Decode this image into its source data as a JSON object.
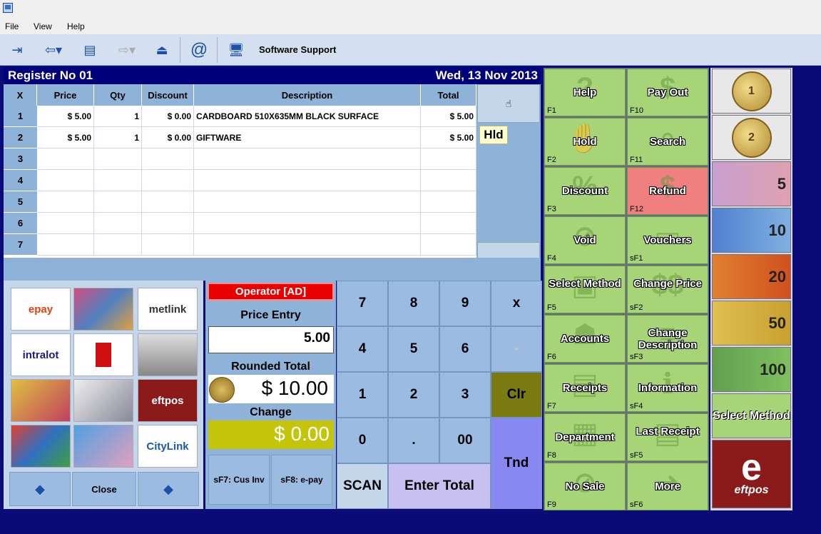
{
  "menu": [
    "File",
    "View",
    "Help"
  ],
  "toolbar": {
    "support_label": "Software Support"
  },
  "header": {
    "register": "Register No 01",
    "date": "Wed, 13 Nov 2013"
  },
  "grid": {
    "columns": [
      "X",
      "Price",
      "Qty",
      "Discount",
      "Description",
      "Total"
    ],
    "rows": [
      {
        "n": "1",
        "price": "$ 5.00",
        "qty": "1",
        "discount": "$ 0.00",
        "desc": "CARDBOARD 510X635MM BLACK SURFACE",
        "total": "$ 5.00"
      },
      {
        "n": "2",
        "price": "$ 5.00",
        "qty": "1",
        "discount": "$ 0.00",
        "desc": "GIFTWARE",
        "total": "$ 5.00"
      },
      {
        "n": "3",
        "price": "",
        "qty": "",
        "discount": "",
        "desc": "",
        "total": ""
      },
      {
        "n": "4",
        "price": "",
        "qty": "",
        "discount": "",
        "desc": "",
        "total": ""
      },
      {
        "n": "5",
        "price": "",
        "qty": "",
        "discount": "",
        "desc": "",
        "total": ""
      },
      {
        "n": "6",
        "price": "",
        "qty": "",
        "discount": "",
        "desc": "",
        "total": ""
      },
      {
        "n": "7",
        "price": "",
        "qty": "",
        "discount": "",
        "desc": "",
        "total": ""
      }
    ],
    "hld": "Hld"
  },
  "tiles": [
    "epay",
    "",
    "metlink",
    "intralot",
    "",
    "",
    "",
    "",
    "eftpos",
    "",
    "",
    "CityLink"
  ],
  "nav": {
    "close": "Close"
  },
  "operator": "Operator [AD]",
  "price_entry": {
    "label": "Price Entry",
    "value": "5.00"
  },
  "rounded_total": {
    "label": "Rounded Total",
    "value": "$ 10.00"
  },
  "change": {
    "label": "Change",
    "value": "$ 0.00"
  },
  "func_buttons": {
    "cus_inv": "sF7: Cus Inv",
    "epay": "sF8: e-pay"
  },
  "keypad": {
    "k7": "7",
    "k8": "8",
    "k9": "9",
    "kx": "x",
    "k4": "4",
    "k5": "5",
    "k6": "6",
    "kminus": "-",
    "k1": "1",
    "k2": "2",
    "k3": "3",
    "clr": "Clr",
    "k0": "0",
    "kdot": ".",
    "k00": "00",
    "tnd": "Tnd",
    "scan": "SCAN",
    "enter": "Enter Total"
  },
  "fkeys": [
    {
      "t": "Help",
      "k": "F1"
    },
    {
      "t": "Pay Out",
      "k": "F10"
    },
    {
      "t": "Hold",
      "k": "F2"
    },
    {
      "t": "Search",
      "k": "F11"
    },
    {
      "t": "Discount",
      "k": "F3"
    },
    {
      "t": "Refund",
      "k": "F12"
    },
    {
      "t": "Void",
      "k": "F4"
    },
    {
      "t": "Vouchers",
      "k": "sF1"
    },
    {
      "t": "Select Method",
      "k": "F5"
    },
    {
      "t": "Change Price",
      "k": "sF2"
    },
    {
      "t": "Accounts",
      "k": "F6"
    },
    {
      "t": "Change Description",
      "k": "sF3"
    },
    {
      "t": "Receipts",
      "k": "F7"
    },
    {
      "t": "Information",
      "k": "sF4"
    },
    {
      "t": "Department",
      "k": "F8"
    },
    {
      "t": "Last Receipt",
      "k": "sF5"
    },
    {
      "t": "No Sale",
      "k": "F9"
    },
    {
      "t": "More",
      "k": "sF6"
    }
  ],
  "money": {
    "select_method": "Select Method",
    "eftpos_e": "e",
    "eftpos": "eftpos"
  },
  "colors": {
    "header_bg": "#00007a",
    "fkey_bg": "#a8d478",
    "refund_bg": "#f08080",
    "change_bg": "#c4c40a",
    "operator_bg": "#e80000"
  }
}
